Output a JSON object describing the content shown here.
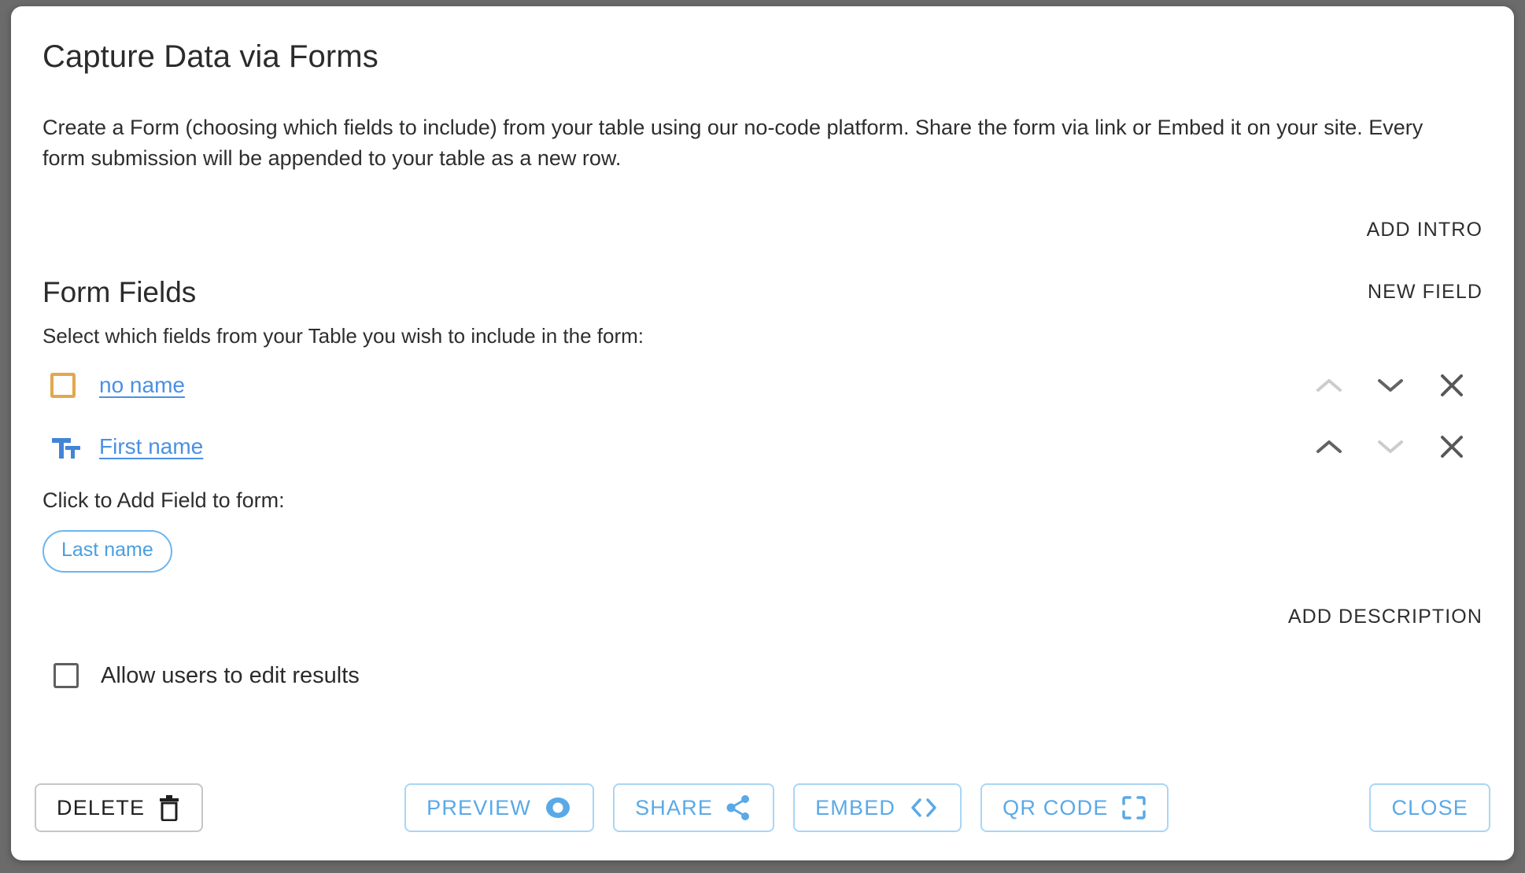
{
  "dialog": {
    "title": "Capture Data via Forms",
    "intro": "Create a Form (choosing which fields to include) from your table using our no-code platform. Share the form via link or Embed it on your site. Every form submission will be appended to your table as a new row.",
    "add_intro_label": "ADD INTRO",
    "add_description_label": "ADD DESCRIPTION"
  },
  "form_fields": {
    "section_title": "Form Fields",
    "new_field_label": "NEW FIELD",
    "select_hint": "Select which fields from your Table you wish to include in the form:",
    "rows": [
      {
        "label": "no name",
        "icon": "checkbox-square-icon",
        "icon_color": "#e0a84e",
        "move_up_enabled": false,
        "move_down_enabled": true
      },
      {
        "label": "First name",
        "icon": "text-format-icon",
        "icon_color": "#4285d6",
        "move_up_enabled": true,
        "move_down_enabled": false
      }
    ],
    "add_field_hint": "Click to Add Field to form:",
    "available_chips": [
      "Last name"
    ]
  },
  "options": {
    "allow_edit_label": "Allow users to edit results",
    "allow_edit_checked": false
  },
  "toolbar": {
    "delete_label": "DELETE",
    "preview_label": "PREVIEW",
    "share_label": "SHARE",
    "embed_label": "EMBED",
    "qr_code_label": "QR CODE",
    "close_label": "CLOSE"
  },
  "colors": {
    "accent_blue": "#5aa9e6",
    "link_blue": "#4a90e2",
    "amber": "#e0a84e",
    "backdrop": "#6b6b6b"
  }
}
